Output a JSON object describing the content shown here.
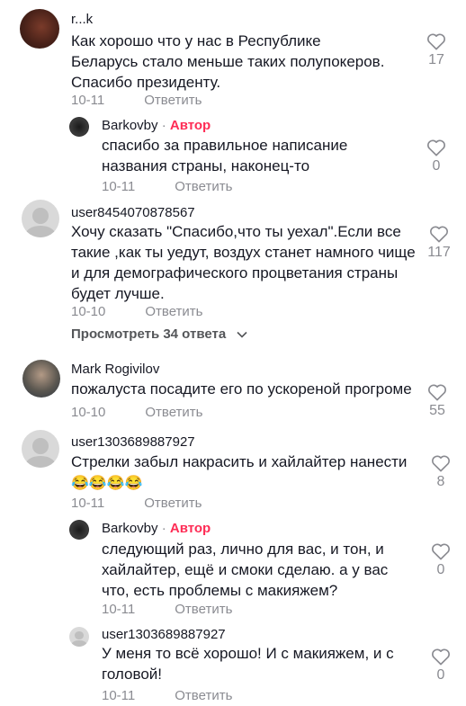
{
  "comments": [
    {
      "username": "r...k",
      "text": "Как хорошо что у нас в Республике Беларусь стало меньше таких полупокеров. Спасибо президенту.",
      "date": "10-11",
      "reply_label": "Ответить",
      "likes": "17",
      "avatar": "user-photo"
    },
    {
      "username": "Barkovby",
      "author_label": "Автор",
      "separator": "·",
      "text": "спасибо за правильное написание названия страны, наконец-то",
      "date": "10-11",
      "reply_label": "Ответить",
      "likes": "0",
      "avatar": "user-photo"
    },
    {
      "username": "user8454070878567",
      "text": "Хочу сказать \"Спасибо,что ты уехал\".Если все такие ,как ты уедут, воздух станет намного чище и для демографического процветания страны будет лучше.",
      "date": "10-10",
      "reply_label": "Ответить",
      "likes": "117",
      "view_replies": "Просмотреть 34 ответа",
      "avatar": "default-avatar"
    },
    {
      "username": "Mark Rogivilov",
      "text": "пожалуста посадите его по ускореной прогроме",
      "date": "10-10",
      "reply_label": "Ответить",
      "likes": "55",
      "avatar": "user-photo"
    },
    {
      "username": "user1303689887927",
      "text": "Стрелки забыл накрасить и хайлайтер нанести",
      "emojis": "😂😂😂😂",
      "date": "10-11",
      "reply_label": "Ответить",
      "likes": "8",
      "avatar": "default-avatar"
    },
    {
      "username": "Barkovby",
      "author_label": "Автор",
      "separator": "·",
      "text": "следующий раз, лично для вас, и тон, и хайлайтер, ещё и смоки сделаю. а у вас что, есть проблемы с макияжем?",
      "date": "10-11",
      "reply_label": "Ответить",
      "likes": "0",
      "avatar": "user-photo"
    },
    {
      "username": "user1303689887927",
      "text": "У меня то всё хорошо! И с макияжем, и с головой!",
      "date": "10-11",
      "reply_label": "Ответить",
      "likes": "0",
      "avatar": "default-avatar"
    }
  ],
  "icons": {
    "like": "heart-outline-icon",
    "expand": "chevron-down-icon"
  },
  "colors": {
    "author": "#fe2c55",
    "secondary_text": "#8a8b91"
  }
}
